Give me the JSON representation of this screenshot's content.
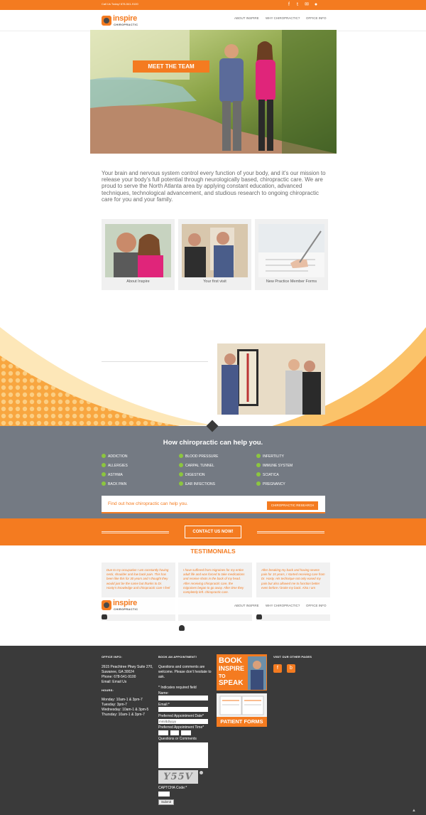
{
  "topbar": {
    "call_text": "Call Us Today! 678-541-9100",
    "social_icons": [
      "facebook-icon",
      "twitter-icon",
      "email-icon",
      "map-pin-icon"
    ]
  },
  "header": {
    "logo_word": "inspire",
    "logo_sub": "CHIROPRACTIC",
    "nav": [
      "ABOUT INSPIRE",
      "WHY CHIROPRACTIC?",
      "OFFICE INFO"
    ]
  },
  "hero": {
    "button_label": "MEET THE TEAM"
  },
  "intro": "Your brain and nervous system control every function of your body, and it’s our mission to release your body’s full potential through neurologically based, chiropractic care. We are proud to serve the North Atlanta area by applying constant education, advanced techniques, technological advancement, and studious research to ongoing chiropractic care for you and your family.",
  "cards": [
    {
      "label": "About Inspire"
    },
    {
      "label": "Your first visit"
    },
    {
      "label": "New Practice Member Forms"
    }
  ],
  "how": {
    "title": "How chiropractic can help you.",
    "conditions": [
      [
        "ADDICTION",
        "ALLERGIES",
        "ASTHMA",
        "BACK PAIN"
      ],
      [
        "BLOOD PRESSURE",
        "CARPAL TUNNEL",
        "DIGESTION",
        "EAR INFECTIONS"
      ],
      [
        "INFERTILITY",
        "IMMUNE SYSTEM",
        "SCIATICA",
        "PREGNANCY"
      ]
    ],
    "find_text": "Find out how chiropractic can help you.",
    "research_button": "CHIROPRACTIC RESEARCH"
  },
  "contact": {
    "button_label": "CONTACT US NOW!"
  },
  "testimonials": {
    "title": "TESTIMONIALS",
    "items": [
      "Due to my occupation I am constantly having neck, shoulder and low back pain. This has been like this for 30 years and I thought they would just be the same but thanks to Dr. Hasty’s knowledge and chiropractic care I feel",
      "I have suffered from migraines for my entire adult life and was forced to take medications and receive shots in the back of my head. After receiving chiropractic care, the migraines began to go away. After time they completely left. chiropractic care.",
      "After breaking my back and having severe pain for 15 years, I started receiving care from Dr. Hasty. His technique not only eased my pain but also allowed me to function better even before I broke my back. Also I am"
    ]
  },
  "footer": {
    "office_heading": "OFFICE INFO:",
    "office_lines": [
      "2615 Peachtree Pkwy Suite 270,",
      "Suwanee, GA 30024",
      "Phone: 678-541-9100",
      "Email: Email Us"
    ],
    "hours_heading": "HOURS:",
    "hours_lines": [
      "Monday: 10am-1 & 3pm-7",
      "Tuesday: 3pm-7",
      "Wednesday: 10am-1 & 3pm-5",
      "Thursday: 10am-1 & 3pm-7"
    ],
    "appt_heading": "BOOK AN APPOINTMENT!",
    "appt_intro": "Questions and comments are welcome. Please don’t hesitate to ask.",
    "required_note": "* Indicates required field",
    "name_label": "Name:",
    "email_label": "Email:*",
    "date_label": "Preferred Appointment Date*",
    "date_placeholder": "mm/dd/yyyy",
    "time_label": "Preferred Appointment Time*",
    "questions_label": "Questions or Comments",
    "captcha_text": "Y55V",
    "captcha_label": "CAPTCHA Code:*",
    "submit_label": "Submit",
    "book_lines": [
      "BOOK",
      "INSPIRE",
      "TO",
      "SPEAK"
    ],
    "forms_label": "PATIENT FORMS",
    "visit_heading": "VISIT OUR OTHER PAGES"
  },
  "colors": {
    "accent": "#f47b20",
    "slate": "#747a83",
    "footer": "#3a3a3a",
    "check": "#8cc63f"
  }
}
